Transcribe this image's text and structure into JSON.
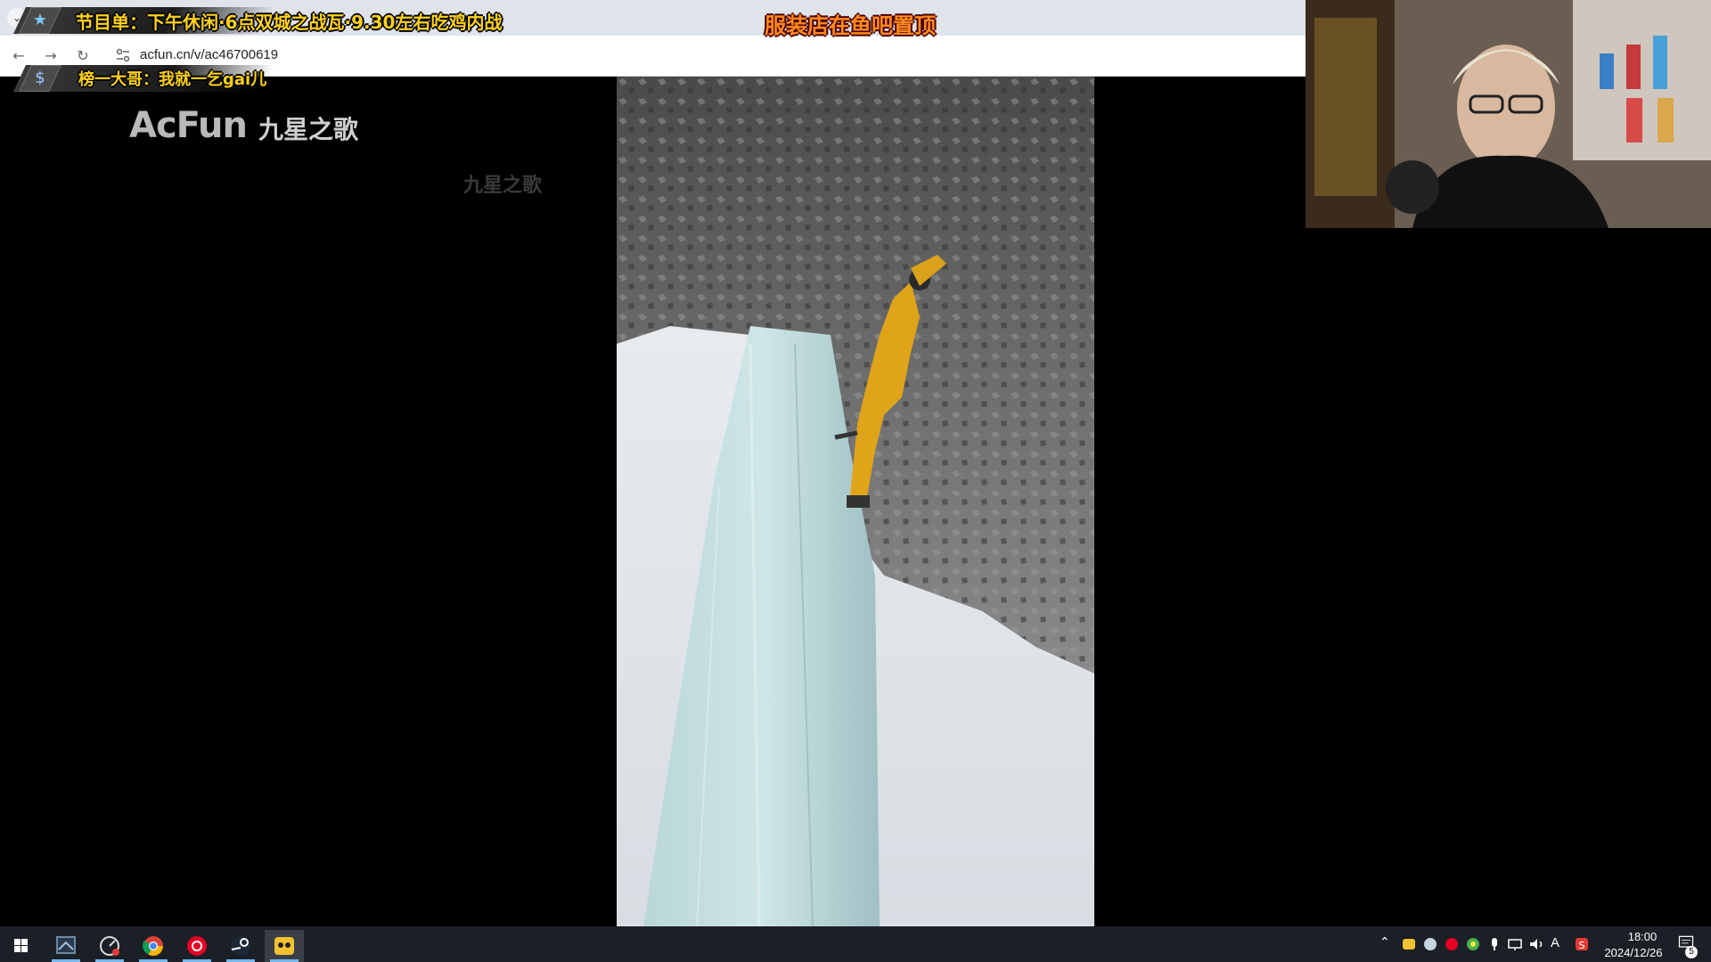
{
  "browser": {
    "url": "acfun.cn/v/ac46700619",
    "icons": [
      "back-arrow-icon",
      "forward-arrow-icon",
      "reload-icon",
      "site-info-icon",
      "tab-dropdown-icon"
    ]
  },
  "overlay": {
    "schedule": "节目单：下午休闲·6点双城之战瓦·9.30左右吃鸡内战",
    "pinned": "服装店在鱼吧置顶",
    "top_donor": "榜一大哥：我就一乞gai儿",
    "badge_icons": [
      "star-icon",
      "dollar-icon"
    ]
  },
  "video_page": {
    "logo_brand": "AcFun",
    "logo_channel": "九星之歌",
    "watermark": "九星之歌"
  },
  "taskbar": {
    "apps": [
      "windows-start-icon",
      "screen-app-icon",
      "speed-app-icon",
      "chrome-icon",
      "netease-music-icon",
      "steam-icon",
      "bilibili-face-icon"
    ],
    "tray_icons": [
      "chevron-up-icon",
      "app-tray-icon",
      "steam-tray-icon",
      "music-tray-icon",
      "chrome-tray-icon",
      "mic-icon",
      "network-icon",
      "volume-icon",
      "ime-icon",
      "sogou-icon",
      "notification-icon"
    ],
    "ime_label": "A",
    "time": "18:00",
    "date": "2024/12/26",
    "notification_count": "5"
  },
  "colors": {
    "overlay_yellow": "#ffd21a",
    "overlay_orange": "#ff8a1e",
    "taskbar": "#1b1f26",
    "browser_chrome": "#dfe3ea"
  }
}
